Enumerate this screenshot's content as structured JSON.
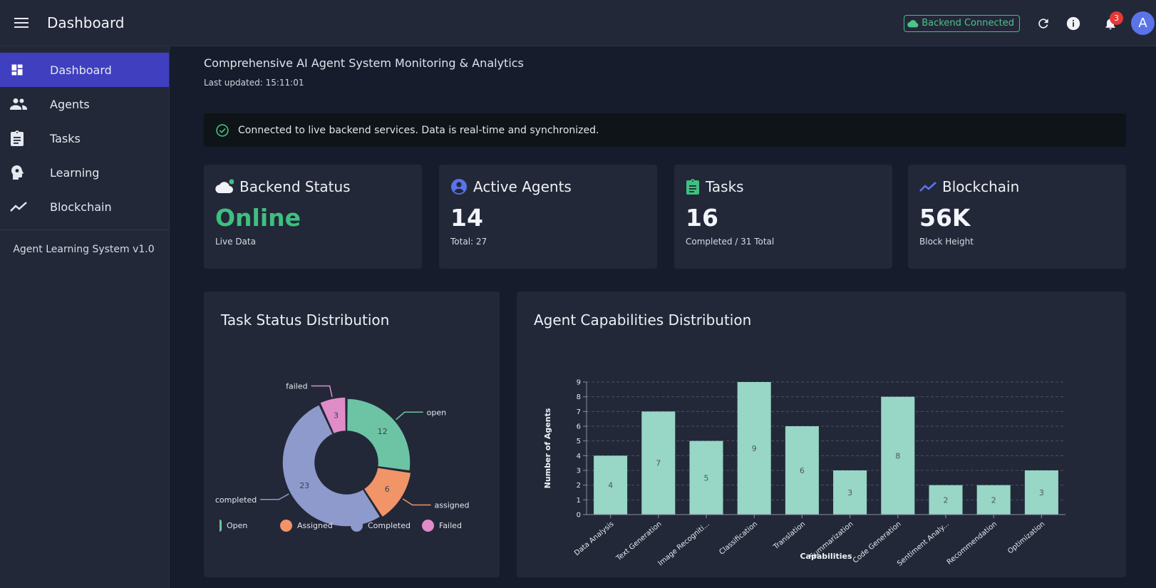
{
  "app": {
    "title": "Dashboard"
  },
  "topbar": {
    "backend_chip": "Backend Connected",
    "notifications_count": "3",
    "avatar_letter": "A"
  },
  "sidebar": {
    "items": [
      {
        "label": "Dashboard",
        "icon": "dashboard-icon",
        "active": true
      },
      {
        "label": "Agents",
        "icon": "people-icon",
        "active": false
      },
      {
        "label": "Tasks",
        "icon": "clipboard-icon",
        "active": false
      },
      {
        "label": "Learning",
        "icon": "brain-icon",
        "active": false
      },
      {
        "label": "Blockchain",
        "icon": "trend-icon",
        "active": false
      }
    ],
    "version": "Agent Learning System v1.0"
  },
  "header": {
    "subtitle": "Comprehensive AI Agent System Monitoring & Analytics",
    "last_updated": "Last updated: 15:11:01"
  },
  "alert": {
    "text": "Connected to live backend services. Data is real-time and synchronized."
  },
  "cards": [
    {
      "title": "Backend Status",
      "value": "Online",
      "sub": "Live Data",
      "icon": "cloud-icon"
    },
    {
      "title": "Active Agents",
      "value": "14",
      "sub": "Total: 27",
      "icon": "account-circle-icon"
    },
    {
      "title": "Tasks",
      "value": "16",
      "sub": "Completed / 31 Total",
      "icon": "clipboard-icon"
    },
    {
      "title": "Blockchain",
      "value": "56K",
      "sub": "Block Height",
      "icon": "trend-icon"
    }
  ],
  "colors": {
    "accent": "#3f3fc0",
    "online": "#3fbf7f",
    "open": "#6cc4a4",
    "assigned": "#f19468",
    "completed": "#8e9acb",
    "failed": "#e08cc8",
    "bar": "#98d6c6"
  },
  "chart_data": [
    {
      "type": "pie",
      "title": "Task Status Distribution",
      "donut": true,
      "slices": [
        {
          "label": "open",
          "legend": "Open",
          "value": 12
        },
        {
          "label": "assigned",
          "legend": "Assigned",
          "value": 6
        },
        {
          "label": "completed",
          "legend": "Completed",
          "value": 23
        },
        {
          "label": "failed",
          "legend": "Failed",
          "value": 3
        }
      ],
      "legend_position": "bottom"
    },
    {
      "type": "bar",
      "title": "Agent Capabilities Distribution",
      "categories": [
        "Data Analysis",
        "Text Generation",
        "Image Recogniti...",
        "Classification",
        "Translation",
        "Summarization",
        "Code Generation",
        "Sentiment Analy...",
        "Recommendation",
        "Optimization"
      ],
      "values": [
        4,
        7,
        5,
        9,
        6,
        3,
        8,
        2,
        2,
        3
      ],
      "xlabel": "Capabilities",
      "ylabel": "Number of Agents",
      "ylim": [
        0,
        9
      ],
      "yticks": [
        0,
        1,
        2,
        3,
        4,
        5,
        6,
        7,
        8,
        9
      ],
      "grid": true
    }
  ]
}
